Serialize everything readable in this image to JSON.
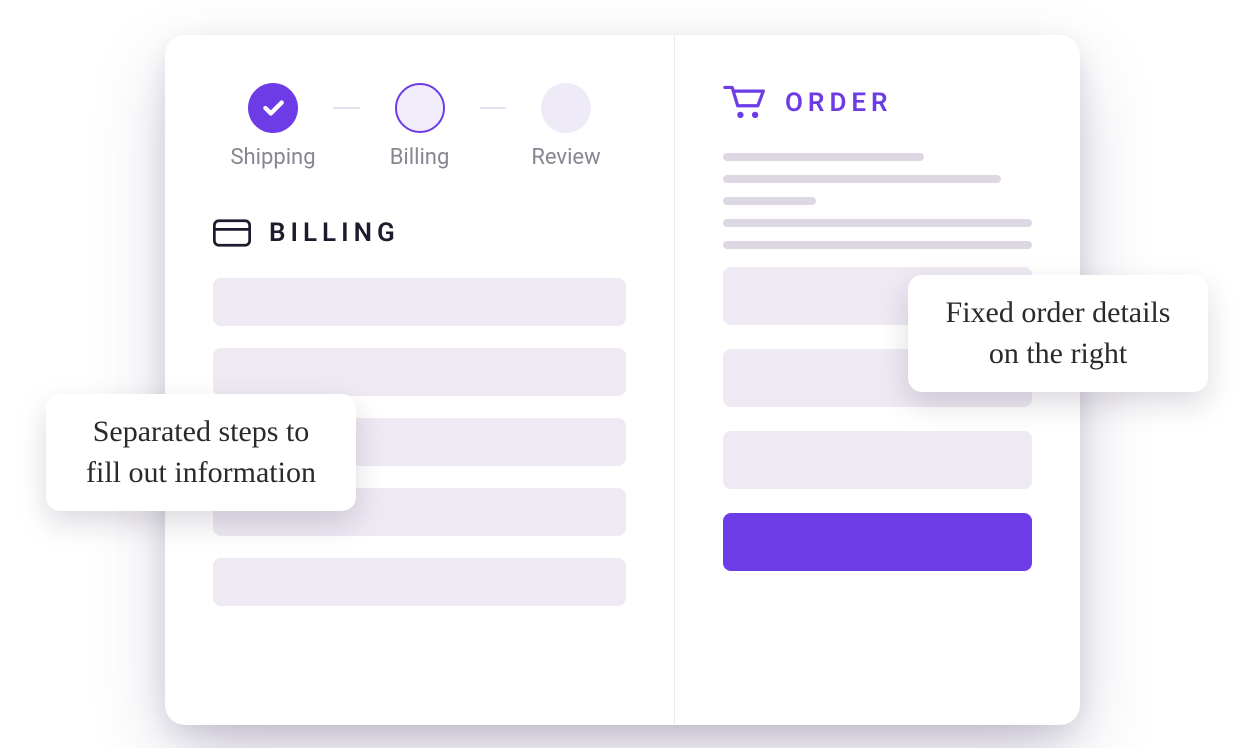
{
  "stepper": {
    "steps": [
      {
        "label": "Shipping",
        "state": "done"
      },
      {
        "label": "Billing",
        "state": "current"
      },
      {
        "label": "Review",
        "state": "future"
      }
    ]
  },
  "left_section": {
    "title": "BILLING"
  },
  "right_section": {
    "title": "ORDER"
  },
  "notes": {
    "left": "Separated steps to fill out information",
    "right": "Fixed order details on the right"
  },
  "colors": {
    "accent": "#6e3ce7",
    "placeholder": "#eee9f3",
    "text_muted": "#8a8593",
    "text_heading": "#1f1a2e"
  }
}
